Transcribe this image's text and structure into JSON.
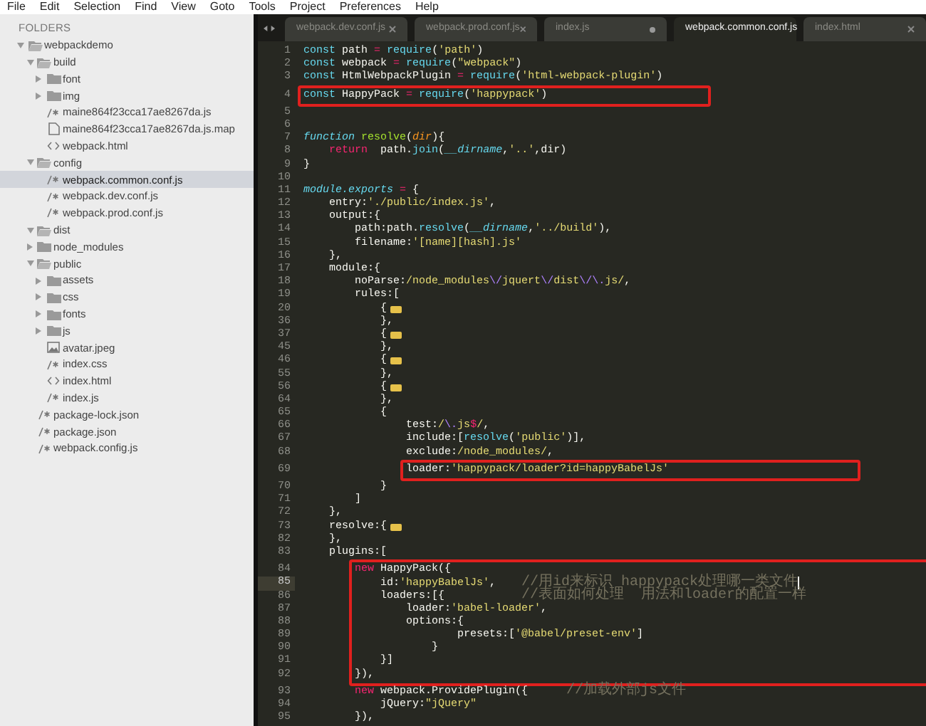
{
  "menu_bar": [
    "File",
    "Edit",
    "Selection",
    "Find",
    "View",
    "Goto",
    "Tools",
    "Project",
    "Preferences",
    "Help"
  ],
  "sidebar": {
    "heading": "FOLDERS",
    "tree": [
      {
        "name": "webpackdemo",
        "kind": "folder",
        "expanded": true,
        "selected": false,
        "children": [
          {
            "name": "build",
            "kind": "folder",
            "expanded": true,
            "selected": false,
            "children": [
              {
                "name": "font",
                "kind": "folder",
                "expanded": false,
                "selected": false
              },
              {
                "name": "img",
                "kind": "folder",
                "expanded": false,
                "selected": false
              },
              {
                "name": "maine864f23cca17ae8267da.js",
                "kind": "code",
                "selected": false
              },
              {
                "name": "maine864f23cca17ae8267da.js.map",
                "kind": "file",
                "selected": false
              },
              {
                "name": "webpack.html",
                "kind": "html",
                "selected": false
              }
            ]
          },
          {
            "name": "config",
            "kind": "folder",
            "expanded": true,
            "selected": false,
            "children": [
              {
                "name": "webpack.common.conf.js",
                "kind": "code",
                "selected": true
              },
              {
                "name": "webpack.dev.conf.js",
                "kind": "code",
                "selected": false
              },
              {
                "name": "webpack.prod.conf.js",
                "kind": "code",
                "selected": false
              }
            ]
          },
          {
            "name": "dist",
            "kind": "folder",
            "expanded": true,
            "selected": false
          },
          {
            "name": "node_modules",
            "kind": "folder",
            "expanded": false,
            "selected": false
          },
          {
            "name": "public",
            "kind": "folder",
            "expanded": true,
            "selected": false,
            "children": [
              {
                "name": "assets",
                "kind": "folder",
                "expanded": false,
                "selected": false
              },
              {
                "name": "css",
                "kind": "folder",
                "expanded": false,
                "selected": false
              },
              {
                "name": "fonts",
                "kind": "folder",
                "expanded": false,
                "selected": false
              },
              {
                "name": "js",
                "kind": "folder",
                "expanded": false,
                "selected": false
              },
              {
                "name": "avatar.jpeg",
                "kind": "image",
                "selected": false
              },
              {
                "name": "index.css",
                "kind": "code",
                "selected": false
              },
              {
                "name": "index.html",
                "kind": "html",
                "selected": false
              },
              {
                "name": "index.js",
                "kind": "code",
                "selected": false
              }
            ]
          },
          {
            "name": "package-lock.json",
            "kind": "code",
            "selected": false
          },
          {
            "name": "package.json",
            "kind": "code",
            "selected": false
          },
          {
            "name": "webpack.config.js",
            "kind": "code",
            "selected": false
          }
        ]
      }
    ]
  },
  "editor": {
    "tabs": [
      {
        "label": "webpack.dev.conf.js",
        "selected": false,
        "modified": false
      },
      {
        "label": "webpack.prod.conf.js",
        "selected": false,
        "modified": false
      },
      {
        "label": "index.js",
        "selected": false,
        "modified": true
      },
      {
        "label": "webpack.common.conf.js",
        "selected": true,
        "modified": false
      },
      {
        "label": "index.html",
        "selected": false,
        "modified": false
      }
    ],
    "sections": [
      {
        "boxed": false,
        "lines": [
          {
            "number": "1",
            "current": false,
            "tokens": [
              {
                "kind": "keyword",
                "text": "const"
              },
              {
                "kind": "plain",
                "text": " path "
              },
              {
                "kind": "operator",
                "text": "= "
              },
              {
                "kind": "support",
                "text": "require"
              },
              {
                "kind": "plain",
                "text": "("
              },
              {
                "kind": "string",
                "text": "'path'"
              },
              {
                "kind": "plain",
                "text": ")"
              }
            ]
          },
          {
            "number": "2",
            "current": false,
            "tokens": [
              {
                "kind": "keyword",
                "text": "const"
              },
              {
                "kind": "plain",
                "text": " webpack "
              },
              {
                "kind": "operator",
                "text": "= "
              },
              {
                "kind": "support",
                "text": "require"
              },
              {
                "kind": "plain",
                "text": "("
              },
              {
                "kind": "string",
                "text": "\"webpack\""
              },
              {
                "kind": "plain",
                "text": ")"
              }
            ]
          },
          {
            "number": "3",
            "current": false,
            "tokens": [
              {
                "kind": "keyword",
                "text": "const"
              },
              {
                "kind": "plain",
                "text": " HtmlWebpackPlugin "
              },
              {
                "kind": "operator",
                "text": "= "
              },
              {
                "kind": "support",
                "text": "require"
              },
              {
                "kind": "plain",
                "text": "("
              },
              {
                "kind": "string",
                "text": "'html-webpack-plugin'"
              },
              {
                "kind": "plain",
                "text": ")"
              }
            ]
          }
        ]
      },
      {
        "boxed": true,
        "lines": [
          {
            "number": "4",
            "current": false,
            "tokens": [
              {
                "kind": "keyword",
                "text": "const"
              },
              {
                "kind": "plain",
                "text": " HappyPack "
              },
              {
                "kind": "operator",
                "text": "= "
              },
              {
                "kind": "support",
                "text": "require"
              },
              {
                "kind": "plain",
                "text": "("
              },
              {
                "kind": "string",
                "text": "'happypack'"
              },
              {
                "kind": "plain",
                "text": ")"
              }
            ]
          }
        ]
      },
      {
        "boxed": false,
        "lines": [
          {
            "number": "5",
            "current": false
          },
          {
            "number": "6",
            "current": false
          },
          {
            "number": "7",
            "current": false,
            "tokens": [
              {
                "kind": "italic",
                "text": "function "
              },
              {
                "kind": "name",
                "text": "resolve"
              },
              {
                "kind": "plain",
                "text": "("
              },
              {
                "kind": "param",
                "text": "dir"
              },
              {
                "kind": "plain",
                "text": "){"
              }
            ]
          },
          {
            "number": "8",
            "current": false,
            "tokens": [
              {
                "kind": "operator",
                "text": "    return"
              },
              {
                "kind": "plain",
                "text": "  path."
              },
              {
                "kind": "support",
                "text": "join"
              },
              {
                "kind": "plain",
                "text": "("
              },
              {
                "kind": "italic",
                "text": "__dirname"
              },
              {
                "kind": "plain",
                "text": ","
              },
              {
                "kind": "string",
                "text": "'..'"
              },
              {
                "kind": "plain",
                "text": ",dir)"
              }
            ]
          },
          {
            "number": "9",
            "current": false,
            "tokens": [
              {
                "kind": "plain",
                "text": "}"
              }
            ]
          },
          {
            "number": "10",
            "current": false
          },
          {
            "number": "11",
            "current": false,
            "tokens": [
              {
                "kind": "italic",
                "text": "module.exports "
              },
              {
                "kind": "operator",
                "text": "="
              },
              {
                "kind": "plain",
                "text": " {"
              }
            ]
          },
          {
            "number": "12",
            "current": false,
            "tokens": [
              {
                "kind": "plain",
                "text": "    entry:"
              },
              {
                "kind": "string",
                "text": "'./public/index.js'"
              },
              {
                "kind": "plain",
                "text": ","
              }
            ]
          },
          {
            "number": "13",
            "current": false,
            "tokens": [
              {
                "kind": "plain",
                "text": "    output:{"
              }
            ]
          },
          {
            "number": "14",
            "current": false,
            "tokens": [
              {
                "kind": "plain",
                "text": "        path:path."
              },
              {
                "kind": "support",
                "text": "resolve"
              },
              {
                "kind": "plain",
                "text": "("
              },
              {
                "kind": "italic",
                "text": "__dirname"
              },
              {
                "kind": "plain",
                "text": ","
              },
              {
                "kind": "string",
                "text": "'../build'"
              },
              {
                "kind": "plain",
                "text": "),"
              }
            ]
          },
          {
            "number": "15",
            "current": false,
            "tokens": [
              {
                "kind": "plain",
                "text": "        filename:"
              },
              {
                "kind": "string",
                "text": "'[name][hash].js'"
              }
            ]
          },
          {
            "number": "16",
            "current": false,
            "tokens": [
              {
                "kind": "plain",
                "text": "    },"
              }
            ]
          },
          {
            "number": "17",
            "current": false,
            "tokens": [
              {
                "kind": "plain",
                "text": "    module:{"
              }
            ]
          },
          {
            "number": "18",
            "current": false,
            "tokens": [
              {
                "kind": "plain",
                "text": "        noParse:"
              },
              {
                "kind": "regex",
                "text": "/node_modules"
              },
              {
                "kind": "escape",
                "text": "\\/"
              },
              {
                "kind": "regex",
                "text": "jquert"
              },
              {
                "kind": "escape",
                "text": "\\/"
              },
              {
                "kind": "regex",
                "text": "dist"
              },
              {
                "kind": "escape",
                "text": "\\/\\."
              },
              {
                "kind": "regex",
                "text": "js/"
              },
              {
                "kind": "plain",
                "text": ","
              }
            ]
          },
          {
            "number": "19",
            "current": false,
            "tokens": [
              {
                "kind": "plain",
                "text": "        rules:["
              }
            ]
          },
          {
            "number": "20",
            "current": false,
            "tokens": [
              {
                "kind": "plain",
                "text": "            {"
              },
              {
                "kind": "fold"
              }
            ]
          },
          {
            "number": "36",
            "current": false,
            "tokens": [
              {
                "kind": "plain",
                "text": "            },"
              }
            ]
          },
          {
            "number": "37",
            "current": false,
            "tokens": [
              {
                "kind": "plain",
                "text": "            {"
              },
              {
                "kind": "fold"
              }
            ]
          },
          {
            "number": "45",
            "current": false,
            "tokens": [
              {
                "kind": "plain",
                "text": "            },"
              }
            ]
          },
          {
            "number": "46",
            "current": false,
            "tokens": [
              {
                "kind": "plain",
                "text": "            {"
              },
              {
                "kind": "fold"
              }
            ]
          },
          {
            "number": "55",
            "current": false,
            "tokens": [
              {
                "kind": "plain",
                "text": "            },"
              }
            ]
          },
          {
            "number": "56",
            "current": false,
            "tokens": [
              {
                "kind": "plain",
                "text": "            {"
              },
              {
                "kind": "fold"
              }
            ]
          },
          {
            "number": "64",
            "current": false,
            "tokens": [
              {
                "kind": "plain",
                "text": "            },"
              }
            ]
          },
          {
            "number": "65",
            "current": false,
            "tokens": [
              {
                "kind": "plain",
                "text": "            {"
              }
            ]
          },
          {
            "number": "66",
            "current": false,
            "tokens": [
              {
                "kind": "plain",
                "text": "                test:"
              },
              {
                "kind": "regex",
                "text": "/"
              },
              {
                "kind": "escape",
                "text": "\\."
              },
              {
                "kind": "regex",
                "text": "js"
              },
              {
                "kind": "operator",
                "text": "$"
              },
              {
                "kind": "regex",
                "text": "/"
              },
              {
                "kind": "plain",
                "text": ","
              }
            ]
          },
          {
            "number": "67",
            "current": false,
            "tokens": [
              {
                "kind": "plain",
                "text": "                include:["
              },
              {
                "kind": "support",
                "text": "resolve"
              },
              {
                "kind": "plain",
                "text": "("
              },
              {
                "kind": "string",
                "text": "'public'"
              },
              {
                "kind": "plain",
                "text": ")],"
              }
            ]
          },
          {
            "number": "68",
            "current": false,
            "tokens": [
              {
                "kind": "plain",
                "text": "                exclude:"
              },
              {
                "kind": "regex",
                "text": "/node_modules/"
              },
              {
                "kind": "plain",
                "text": ","
              }
            ]
          }
        ]
      },
      {
        "boxed": true,
        "lines": [
          {
            "number": "69",
            "current": false,
            "tokens": [
              {
                "kind": "plain",
                "text": "                loader:"
              },
              {
                "kind": "string",
                "text": "'happypack/loader?id=happyBabelJs'"
              }
            ]
          }
        ]
      },
      {
        "boxed": false,
        "lines": [
          {
            "number": "70",
            "current": false,
            "tokens": [
              {
                "kind": "plain",
                "text": "            }"
              }
            ]
          },
          {
            "number": "71",
            "current": false,
            "tokens": [
              {
                "kind": "plain",
                "text": "        ]"
              }
            ]
          },
          {
            "number": "72",
            "current": false,
            "tokens": [
              {
                "kind": "plain",
                "text": "    },"
              }
            ]
          },
          {
            "number": "73",
            "current": false,
            "tokens": [
              {
                "kind": "plain",
                "text": "    resolve:{"
              },
              {
                "kind": "fold"
              }
            ]
          },
          {
            "number": "82",
            "current": false,
            "tokens": [
              {
                "kind": "plain",
                "text": "    },"
              }
            ]
          },
          {
            "number": "83",
            "current": false,
            "tokens": [
              {
                "kind": "plain",
                "text": "    plugins:["
              }
            ]
          }
        ]
      },
      {
        "boxed": true,
        "lines": [
          {
            "number": "84",
            "current": false,
            "tokens": [
              {
                "kind": "operator",
                "text": "        new"
              },
              {
                "kind": "plain",
                "text": " HappyPack({"
              }
            ]
          },
          {
            "number": "85",
            "current": true,
            "tokens": [
              {
                "kind": "plain",
                "text": "            id:"
              },
              {
                "kind": "string",
                "text": "'happyBabelJs'"
              },
              {
                "kind": "plain",
                "text": ",    "
              },
              {
                "kind": "comment",
                "text": "//用id来标识 happypack处理哪一类文件"
              }
            ]
          },
          {
            "number": "86",
            "current": false,
            "tokens": [
              {
                "kind": "plain",
                "text": "            loaders:[{            "
              },
              {
                "kind": "comment",
                "text": "//表面如何处理  用法和loader的配置一样"
              }
            ]
          },
          {
            "number": "87",
            "current": false,
            "tokens": [
              {
                "kind": "plain",
                "text": "                loader:"
              },
              {
                "kind": "string",
                "text": "'babel-loader'"
              },
              {
                "kind": "plain",
                "text": ","
              }
            ]
          },
          {
            "number": "88",
            "current": false,
            "tokens": [
              {
                "kind": "plain",
                "text": "                options:{"
              }
            ]
          },
          {
            "number": "89",
            "current": false,
            "tokens": [
              {
                "kind": "plain",
                "text": "                        presets:["
              },
              {
                "kind": "string",
                "text": "'@babel/preset-env'"
              },
              {
                "kind": "plain",
                "text": "]"
              }
            ]
          },
          {
            "number": "90",
            "current": false,
            "tokens": [
              {
                "kind": "plain",
                "text": "                    }"
              }
            ]
          },
          {
            "number": "91",
            "current": false,
            "tokens": [
              {
                "kind": "plain",
                "text": "            }]"
              }
            ]
          },
          {
            "number": "92",
            "current": false,
            "tokens": [
              {
                "kind": "plain",
                "text": "        }),"
              }
            ]
          }
        ]
      },
      {
        "boxed": false,
        "lines": [
          {
            "number": "93",
            "current": false,
            "tokens": [
              {
                "kind": "operator",
                "text": "        new"
              },
              {
                "kind": "plain",
                "text": " webpack.ProvidePlugin({      "
              },
              {
                "kind": "comment",
                "text": "//加载外部js文件"
              }
            ]
          },
          {
            "number": "94",
            "current": false,
            "tokens": [
              {
                "kind": "plain",
                "text": "            jQuery:"
              },
              {
                "kind": "string",
                "text": "\"jQuery\""
              }
            ]
          },
          {
            "number": "95",
            "current": false,
            "tokens": [
              {
                "kind": "plain",
                "text": "        }),"
              }
            ]
          }
        ]
      }
    ]
  }
}
